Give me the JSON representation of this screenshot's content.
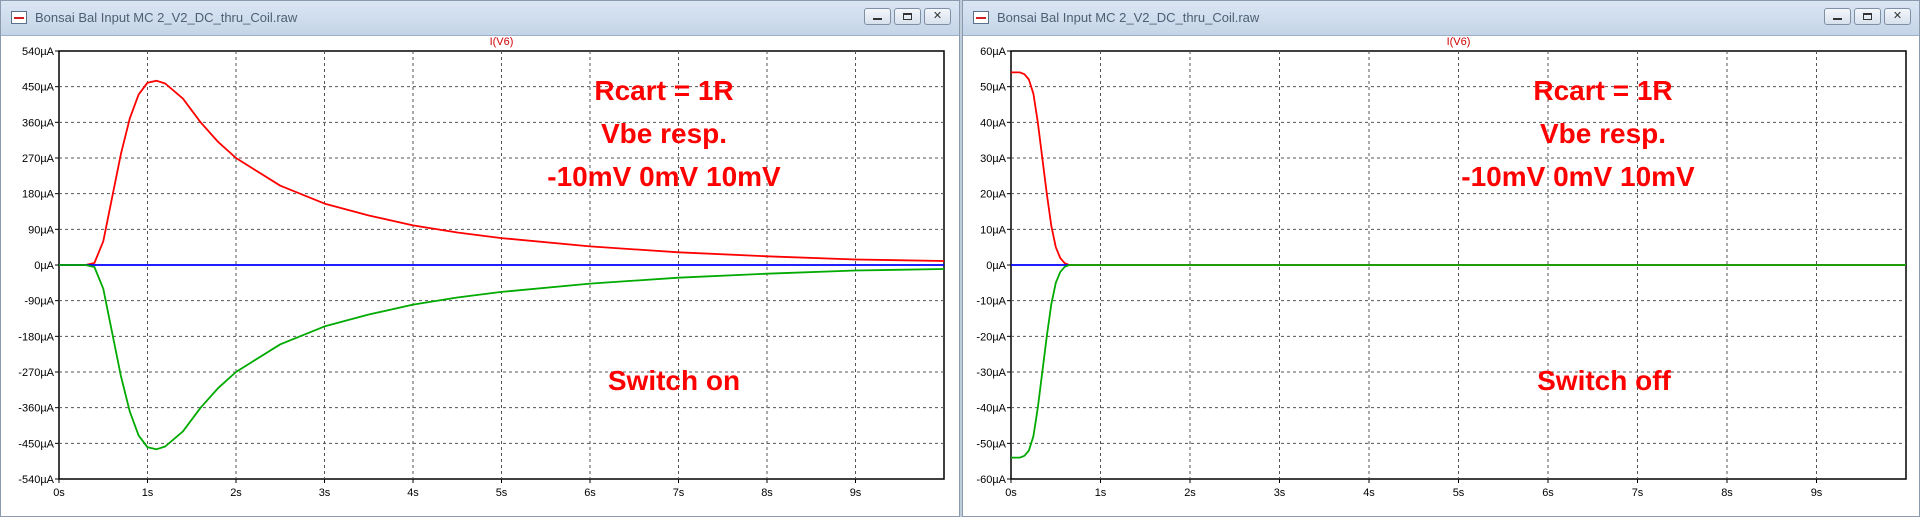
{
  "windows": [
    {
      "title": "Bonsai Bal Input MC 2_V2_DC_thru_Coil.raw",
      "trace_label": "I(V6)",
      "annotations": [
        "Rcart = 1R",
        "Vbe resp.",
        "-10mV  0mV 10mV",
        "Switch on"
      ],
      "annotation_color": "#ff0000",
      "controls": [
        "minimize-button",
        "maximize-button",
        "close-button"
      ]
    },
    {
      "title": "Bonsai Bal Input MC 2_V2_DC_thru_Coil.raw",
      "trace_label": "I(V6)",
      "annotations": [
        "Rcart = 1R",
        "Vbe resp.",
        "-10mV  0mV 10mV",
        "Switch off"
      ],
      "annotation_color": "#ff0000",
      "controls": [
        "minimize-button",
        "maximize-button",
        "close-button"
      ]
    }
  ],
  "chart_data": [
    {
      "type": "line",
      "title": "I(V6)",
      "xlabel": "",
      "ylabel": "",
      "x_unit": "s",
      "y_unit": "µA",
      "xlim": [
        0,
        10
      ],
      "ylim": [
        -540,
        540
      ],
      "xticks": [
        0,
        1,
        2,
        3,
        4,
        5,
        6,
        7,
        8,
        9
      ],
      "xtick_labels": [
        "0s",
        "1s",
        "2s",
        "3s",
        "4s",
        "5s",
        "6s",
        "7s",
        "8s",
        "9s"
      ],
      "yticks": [
        540,
        450,
        360,
        270,
        180,
        90,
        0,
        -90,
        -180,
        -270,
        -360,
        -450,
        -540
      ],
      "ytick_labels": [
        "540µA",
        "450µA",
        "360µA",
        "270µA",
        "180µA",
        "90µA",
        "0µA",
        "-90µA",
        "-180µA",
        "-270µA",
        "-360µA",
        "-450µA",
        "-540µA"
      ],
      "grid": true,
      "series": [
        {
          "color": "#ff0000",
          "x": [
            0,
            0.3,
            0.4,
            0.5,
            0.6,
            0.7,
            0.8,
            0.9,
            1.0,
            1.1,
            1.2,
            1.4,
            1.6,
            1.8,
            2.0,
            2.5,
            3.0,
            3.5,
            4.0,
            4.5,
            5.0,
            6.0,
            7.0,
            8.0,
            9.0,
            10.0
          ],
          "y": [
            0,
            0,
            5,
            60,
            170,
            280,
            370,
            430,
            460,
            465,
            458,
            420,
            360,
            310,
            270,
            200,
            155,
            125,
            100,
            82,
            68,
            47,
            32,
            22,
            14,
            10
          ]
        },
        {
          "color": "#0000ff",
          "x": [
            0,
            10
          ],
          "y": [
            0,
            0
          ]
        },
        {
          "color": "#00aa00",
          "x": [
            0,
            0.3,
            0.4,
            0.5,
            0.6,
            0.7,
            0.8,
            0.9,
            1.0,
            1.1,
            1.2,
            1.4,
            1.6,
            1.8,
            2.0,
            2.5,
            3.0,
            3.5,
            4.0,
            4.5,
            5.0,
            6.0,
            7.0,
            8.0,
            9.0,
            10.0
          ],
          "y": [
            0,
            0,
            -5,
            -60,
            -170,
            -280,
            -370,
            -430,
            -460,
            -465,
            -458,
            -420,
            -360,
            -310,
            -270,
            -200,
            -155,
            -125,
            -100,
            -82,
            -68,
            -47,
            -32,
            -22,
            -14,
            -10
          ]
        }
      ]
    },
    {
      "type": "line",
      "title": "I(V6)",
      "xlabel": "",
      "ylabel": "",
      "x_unit": "s",
      "y_unit": "µA",
      "xlim": [
        0,
        10
      ],
      "ylim": [
        -60,
        60
      ],
      "xticks": [
        0,
        1,
        2,
        3,
        4,
        5,
        6,
        7,
        8,
        9
      ],
      "xtick_labels": [
        "0s",
        "1s",
        "2s",
        "3s",
        "4s",
        "5s",
        "6s",
        "7s",
        "8s",
        "9s"
      ],
      "yticks": [
        60,
        50,
        40,
        30,
        20,
        10,
        0,
        -10,
        -20,
        -30,
        -40,
        -50,
        -60
      ],
      "ytick_labels": [
        "60µA",
        "50µA",
        "40µA",
        "30µA",
        "20µA",
        "10µA",
        "0µA",
        "-10µA",
        "-20µA",
        "-30µA",
        "-40µA",
        "-50µA",
        "-60µA"
      ],
      "grid": true,
      "series": [
        {
          "color": "#ff0000",
          "x": [
            0,
            0.1,
            0.15,
            0.2,
            0.25,
            0.3,
            0.35,
            0.4,
            0.45,
            0.5,
            0.55,
            0.6,
            0.65,
            10
          ],
          "y": [
            54,
            54,
            53.5,
            52,
            48,
            40,
            30,
            20,
            11,
            5,
            2,
            0.5,
            0,
            0
          ]
        },
        {
          "color": "#0000ff",
          "x": [
            0,
            0.65
          ],
          "y": [
            0,
            0
          ]
        },
        {
          "color": "#00aa00",
          "x": [
            0,
            0.1,
            0.15,
            0.2,
            0.25,
            0.3,
            0.35,
            0.4,
            0.45,
            0.5,
            0.55,
            0.6,
            0.65,
            10
          ],
          "y": [
            -54,
            -54,
            -53.5,
            -52,
            -48,
            -40,
            -30,
            -20,
            -11,
            -5,
            -2,
            -0.5,
            0,
            0
          ]
        }
      ]
    }
  ]
}
